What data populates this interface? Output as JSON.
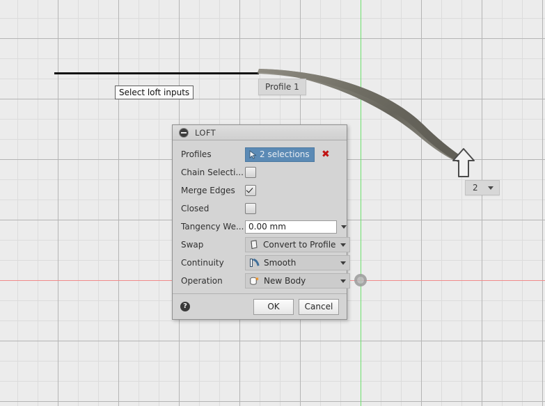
{
  "canvas": {
    "tooltip": "Select loft inputs",
    "profile_label": "Profile 1",
    "count_chip_value": "2",
    "origin_name": "origin-point",
    "axis_x_color": "#f08a8a",
    "axis_y_color": "#6ee06e",
    "background_color": "#ececec",
    "grid_minor_color": "#dcdcdc",
    "grid_major_color": "#b4b4b4",
    "surface_color": "#6f6d63"
  },
  "dialog": {
    "title": "LOFT",
    "accent_selection_color": "#5b8ab5",
    "clear_color": "#c01313",
    "rows": [
      {
        "label": "Profiles",
        "type": "selection",
        "value": "2 selections",
        "icon": "cursor-arrow-icon",
        "clear_glyph": "✖"
      },
      {
        "label": "Chain Selecti...",
        "type": "checkbox",
        "checked": false
      },
      {
        "label": "Merge Edges",
        "type": "checkbox",
        "checked": true
      },
      {
        "label": "Closed",
        "type": "checkbox",
        "checked": false
      },
      {
        "label": "Tangency We...",
        "type": "text",
        "value": "0.00 mm"
      },
      {
        "label": "Swap",
        "type": "combo",
        "value": "Convert to Profile",
        "icon": "profile-surface-icon"
      },
      {
        "label": "Continuity",
        "type": "combo",
        "value": "Smooth",
        "icon": "smooth-continuity-icon"
      },
      {
        "label": "Operation",
        "type": "combo",
        "value": "New Body",
        "icon": "new-body-icon"
      }
    ],
    "footer": {
      "help_glyph": "?",
      "ok_label": "OK",
      "cancel_label": "Cancel"
    }
  }
}
